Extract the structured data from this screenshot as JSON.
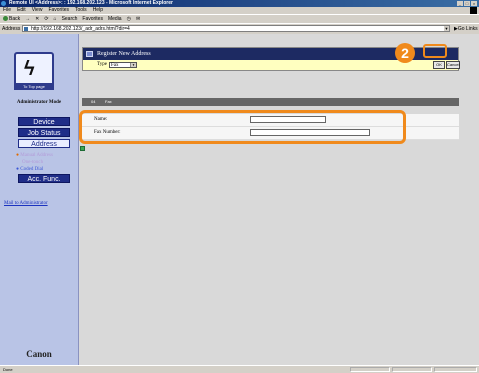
{
  "browser": {
    "title": "Remote UI <Address>: : 192.168.202.123 - Microsoft Internet Explorer",
    "menu": [
      "File",
      "Edit",
      "View",
      "Favorites",
      "Tools",
      "Help"
    ],
    "toolbar": [
      "Back",
      "Search",
      "Favorites",
      "Media"
    ],
    "address_label": "Address",
    "address_url": "http://192.168.202.123/_adr_adrs.html?dir=4",
    "go_label": "Go",
    "links_label": "Links",
    "status": "Done"
  },
  "sidebar": {
    "logo_caption": "To Top page",
    "mode_title": "Administrator Mode",
    "buttons": [
      "Device",
      "Job Status",
      "Address"
    ],
    "subitems": [
      "Manual Address",
      "One-touch",
      "Coded Dial"
    ],
    "acc_func": "Acc. Func.",
    "mail_admin": "Mail to Administrator",
    "brand": "Canon"
  },
  "main": {
    "header_title": "Register New Address",
    "type_label": "Type",
    "type_value": "Fax",
    "ok_label": "OK",
    "cancel_label": "Cancel",
    "callout_number": "2",
    "subtab_code": "04",
    "subtab_name": "Fax",
    "fields": [
      {
        "label": "Name",
        "value": ""
      },
      {
        "label": "Fax Number",
        "value": ""
      }
    ]
  },
  "colors": {
    "callout": "#f08a1c",
    "nav_blue": "#1f2d88",
    "header_blue": "#1d2a62",
    "sidebar_bg": "#b9c4e6"
  }
}
